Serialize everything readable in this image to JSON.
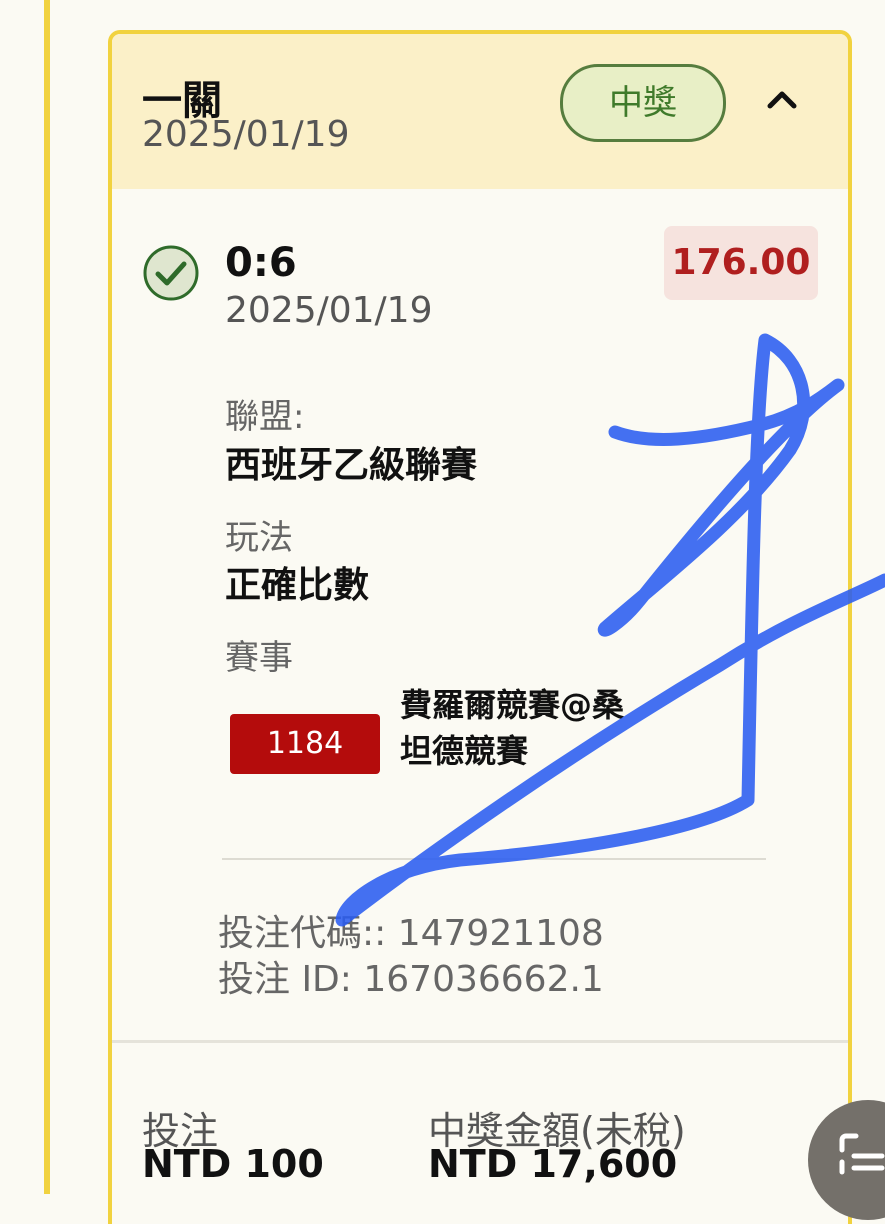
{
  "parlay": {
    "title": "一關",
    "date": "2025/01/19",
    "status_badge": "中獎"
  },
  "selection": {
    "score": "0:6",
    "date": "2025/01/19",
    "odds": "176.00",
    "league_label": "聯盟:",
    "league_value": "西班牙乙級聯賽",
    "market_label": "玩法",
    "market_value": "正確比數",
    "event_label": "賽事",
    "event_number": "1184",
    "event_name": "費羅爾競賽@桑坦德競賽"
  },
  "ticket": {
    "bet_code": "投注代碼:: 147921108",
    "bet_id": "投注 ID: 167036662.1"
  },
  "summary": {
    "stake_label": "投注",
    "stake_value": "NTD 100",
    "payout_label": "中獎金額(未稅)",
    "payout_value": "NTD 17,600"
  },
  "icons": {
    "check": "check-circle-icon",
    "collapse": "chevron-up-icon",
    "scan": "scan-document-icon"
  },
  "colors": {
    "accent_yellow": "#f1d23f",
    "header_bg": "#fbf0c8",
    "win_green": "#3f7a2a",
    "odds_red": "#b01f1f",
    "event_red": "#b40c0c",
    "scribble_blue": "#2a5cf0"
  }
}
